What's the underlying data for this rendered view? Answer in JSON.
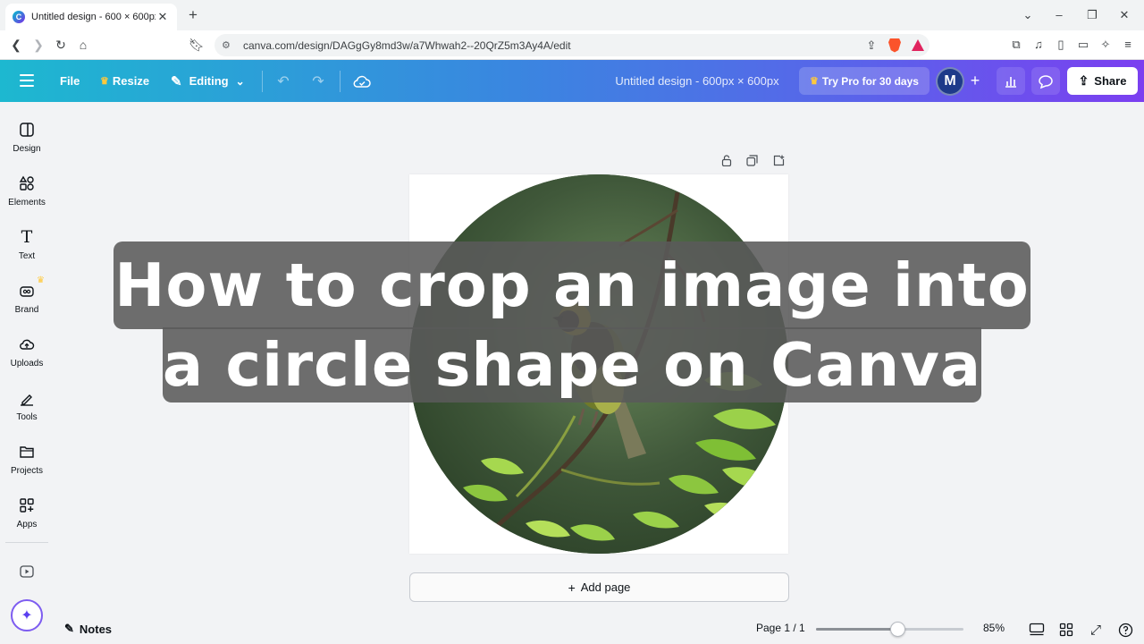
{
  "browser": {
    "tab_title": "Untitled design - 600 × 600px",
    "tab_favicon": "C",
    "url": "canva.com/design/DAGgGy8md3w/a7Whwah2--20QrZ5m3Ay4A/edit",
    "brave_badge": "4"
  },
  "header": {
    "file": "File",
    "resize": "Resize",
    "editing": "Editing",
    "design_title": "Untitled design - 600px × 600px",
    "pro_label": "Try Pro for 30 days",
    "avatar_initial": "M",
    "share": "Share"
  },
  "sidebar": {
    "items": [
      {
        "label": "Design",
        "icon": "design-icon"
      },
      {
        "label": "Elements",
        "icon": "elements-icon"
      },
      {
        "label": "Text",
        "icon": "text-icon"
      },
      {
        "label": "Brand",
        "icon": "brand-icon"
      },
      {
        "label": "Uploads",
        "icon": "uploads-icon"
      },
      {
        "label": "Tools",
        "icon": "tools-icon"
      },
      {
        "label": "Projects",
        "icon": "projects-icon"
      },
      {
        "label": "Apps",
        "icon": "apps-icon"
      }
    ]
  },
  "canvas": {
    "add_page": "Add page"
  },
  "caption": {
    "line1": "How to crop an image into",
    "line2": "a circle shape on Canva"
  },
  "bottom": {
    "notes": "Notes",
    "page_indicator": "Page 1 / 1",
    "zoom": "85%",
    "zoom_fraction": 0.55
  },
  "colors": {
    "header_gradient_start": "#1db8d0",
    "header_gradient_end": "#7b3ff0",
    "crown": "#ffc93c",
    "avatar": "#1e3a8a"
  }
}
